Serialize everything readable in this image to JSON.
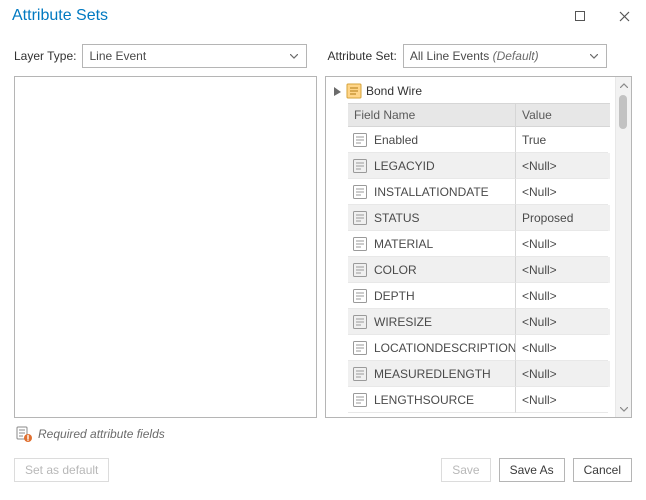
{
  "window": {
    "title": "Attribute Sets"
  },
  "form": {
    "layerTypeLabel": "Layer Type:",
    "layerTypeValue": "Line Event",
    "attributeSetLabel": "Attribute Set:",
    "attributeSetValue": "All Line Events",
    "attributeSetSuffix": "(Default)"
  },
  "tree": {
    "groupName": "Bond Wire"
  },
  "table": {
    "headers": {
      "field": "Field Name",
      "value": "Value"
    },
    "rows": [
      {
        "field": "Enabled",
        "value": "True"
      },
      {
        "field": "LEGACYID",
        "value": "<Null>"
      },
      {
        "field": "INSTALLATIONDATE",
        "value": "<Null>"
      },
      {
        "field": "STATUS",
        "value": "Proposed"
      },
      {
        "field": "MATERIAL",
        "value": "<Null>"
      },
      {
        "field": "COLOR",
        "value": "<Null>"
      },
      {
        "field": "DEPTH",
        "value": "<Null>"
      },
      {
        "field": "WIRESIZE",
        "value": "<Null>"
      },
      {
        "field": "LOCATIONDESCRIPTION",
        "value": "<Null>"
      },
      {
        "field": "MEASUREDLENGTH",
        "value": "<Null>"
      },
      {
        "field": "LENGTHSOURCE",
        "value": "<Null>"
      }
    ]
  },
  "legend": {
    "text": "Required attribute fields"
  },
  "buttons": {
    "setDefault": "Set as default",
    "save": "Save",
    "saveAs": "Save As",
    "cancel": "Cancel"
  }
}
